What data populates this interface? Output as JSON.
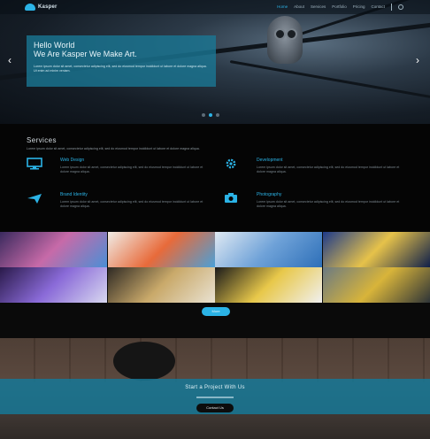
{
  "nav": {
    "brand": "Kasper",
    "items": [
      "Home",
      "About",
      "Services",
      "Portfolio",
      "Pricing",
      "Contact"
    ],
    "active_index": 0
  },
  "hero": {
    "title_line1": "Hello World",
    "title_line2": "We Are Kasper We Make Art.",
    "text": "Lorem ipsum dolor sit amet, consectetur adipiscing elit, sed do eiusmod tempor incididunt ut labore et dolore magna aliqua. Ut enim ad minim veniam.",
    "prev_glyph": "‹",
    "next_glyph": "›",
    "dots": 3,
    "active_dot": 1
  },
  "services": {
    "title": "Services",
    "intro": "Lorem ipsum dolor sit amet, consectetur adipiscing elit, sed do eiusmod tempor incididunt ut labore et dolore magna aliqua.",
    "items": [
      {
        "title": "Web Design",
        "icon": "desktop-icon",
        "text": "Lorem ipsum dolor sit amet, consectetur adipiscing elit, sed do eiusmod tempor incididunt ut labore et dolore magna aliqua."
      },
      {
        "title": "Development",
        "icon": "gear-icon",
        "text": "Lorem ipsum dolor sit amet, consectetur adipiscing elit, sed do eiusmod tempor incididunt ut labore et dolore magna aliqua."
      },
      {
        "title": "Brand Identity",
        "icon": "plane-icon",
        "text": "Lorem ipsum dolor sit amet, consectetur adipiscing elit, sed do eiusmod tempor incididunt ut labore et dolore magna aliqua."
      },
      {
        "title": "Photography",
        "icon": "camera-icon",
        "text": "Lorem ipsum dolor sit amet, consectetur adipiscing elit, sed do eiusmod tempor incididunt ut labore et dolore magna aliqua."
      }
    ]
  },
  "gallery": {
    "more_label": "More",
    "tiles": [
      {
        "name": "anime-city",
        "colors": [
          "#3a2a5e",
          "#c76aa8",
          "#4a8fd6"
        ]
      },
      {
        "name": "skyline-paint",
        "colors": [
          "#f0ece6",
          "#e86a3a",
          "#4aa0d8"
        ]
      },
      {
        "name": "white-street",
        "colors": [
          "#dfe9f3",
          "#6fa2d8",
          "#2d6fb8"
        ]
      },
      {
        "name": "starry-night",
        "colors": [
          "#1d3a8a",
          "#e6c24a",
          "#0f1f4a"
        ]
      },
      {
        "name": "space-ship",
        "colors": [
          "#2a1a4a",
          "#8a6ad8",
          "#d8d8f0"
        ]
      },
      {
        "name": "graffiti-container",
        "colors": [
          "#2f2a24",
          "#c9a96a",
          "#e9e2d2"
        ]
      },
      {
        "name": "graffiti-wall",
        "colors": [
          "#1a1a1a",
          "#e8c84a",
          "#f0f0f0"
        ]
      },
      {
        "name": "robot-truck",
        "colors": [
          "#6b7a82",
          "#d8b43a",
          "#2e3438"
        ]
      }
    ]
  },
  "cta": {
    "text": "Start a Project With Us",
    "button": "Contact Us"
  },
  "colors": {
    "accent": "#2bb3e6",
    "background": "#050505"
  }
}
